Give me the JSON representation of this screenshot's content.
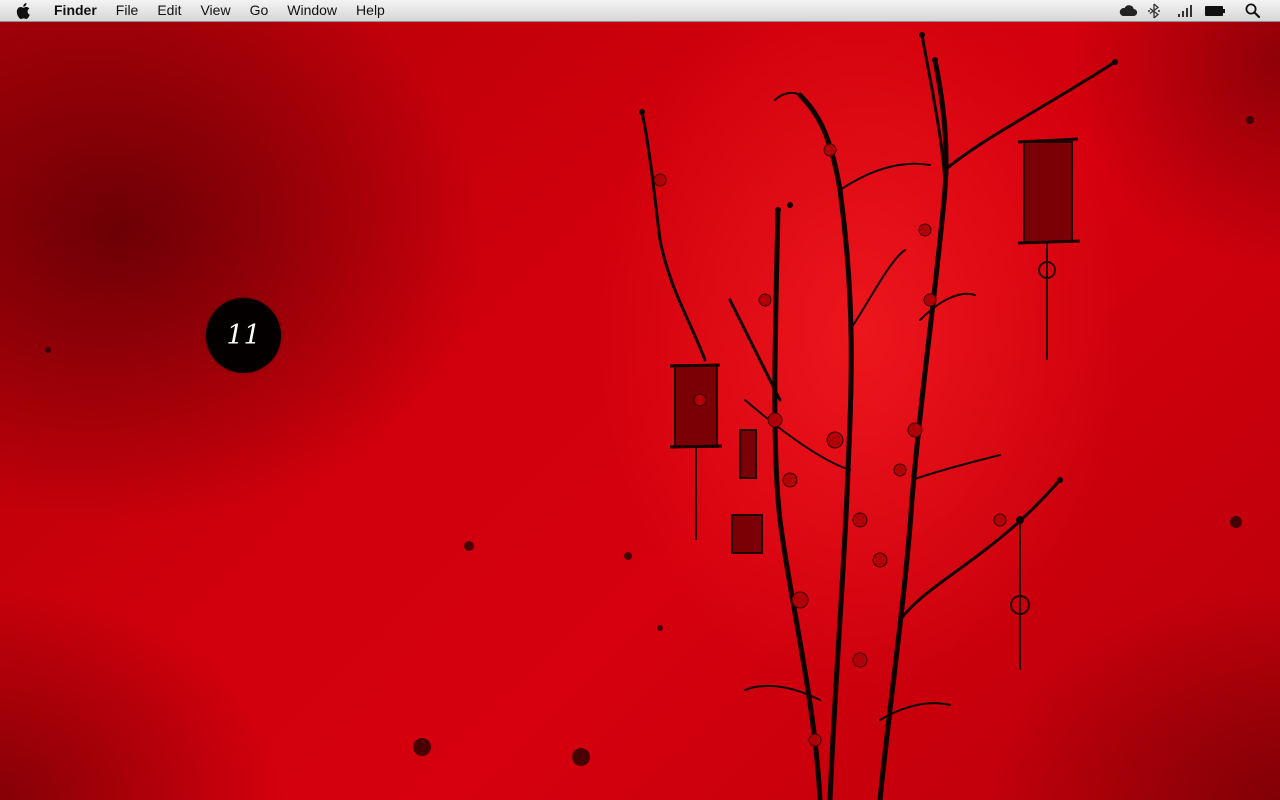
{
  "menubar": {
    "apple_icon": "apple-icon",
    "app_name": "Finder",
    "items": [
      "File",
      "Edit",
      "View",
      "Go",
      "Window",
      "Help"
    ],
    "status_icons": [
      "icloud-icon",
      "bluetooth-icon",
      "wifi-signal-icon",
      "battery-icon",
      "spotlight-search-icon"
    ]
  },
  "desktop": {
    "wallpaper": "red textured wall with black blossom branches and hanging lanterns",
    "colors": {
      "wallpaper_red": "#d0000c",
      "dark_red": "#6a0000",
      "branch_black": "#120000"
    },
    "widget": {
      "day": "11",
      "icon": "date-badge-icon"
    }
  }
}
